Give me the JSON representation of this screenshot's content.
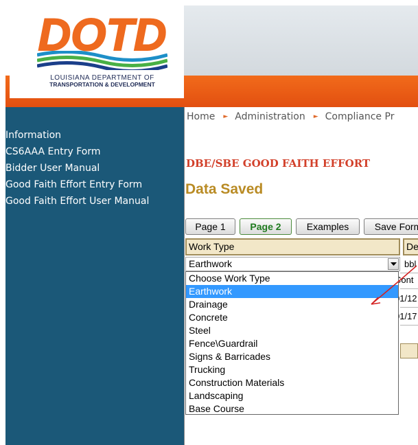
{
  "logo": {
    "wordmark": "DOTD",
    "line1": "LOUISIANA DEPARTMENT OF",
    "line2": "TRANSPORTATION & DEVELOPMENT"
  },
  "sidebar": {
    "items": [
      {
        "label": "Information"
      },
      {
        "label": "CS6AAA Entry Form"
      },
      {
        "label": "Bidder User Manual"
      },
      {
        "label": "Good Faith Effort Entry Form"
      },
      {
        "label": "Good Faith Effort User Manual"
      }
    ]
  },
  "breadcrumb": {
    "items": [
      "Home",
      "Administration",
      "Compliance Pr"
    ]
  },
  "page": {
    "heading": "DBE/SBE GOOD FAITH EFFORT",
    "status": "Data Saved"
  },
  "toolbar": {
    "page1_label": "Page 1",
    "page2_label": "Page 2",
    "examples_label": "Examples",
    "save_label": "Save Form"
  },
  "grid": {
    "headers": [
      "Work Type",
      "De"
    ],
    "desc_value": "bbl",
    "cont_label": "Cont",
    "date1": "01/12",
    "date2": "01/17"
  },
  "work_type": {
    "selected": "Earthwork",
    "options": [
      "Choose Work Type",
      "Earthwork",
      "Drainage",
      "Concrete",
      "Steel",
      "Fence\\Guardrail",
      "Signs & Barricades",
      "Trucking",
      "Construction Materials",
      "Landscaping",
      "Base Course"
    ]
  },
  "colors": {
    "sidebar_bg": "#1b5878",
    "orange_band": "#f26b1b",
    "heading_red": "#d2402a",
    "status_gold": "#b98b24",
    "selected_option": "#3399ff"
  }
}
